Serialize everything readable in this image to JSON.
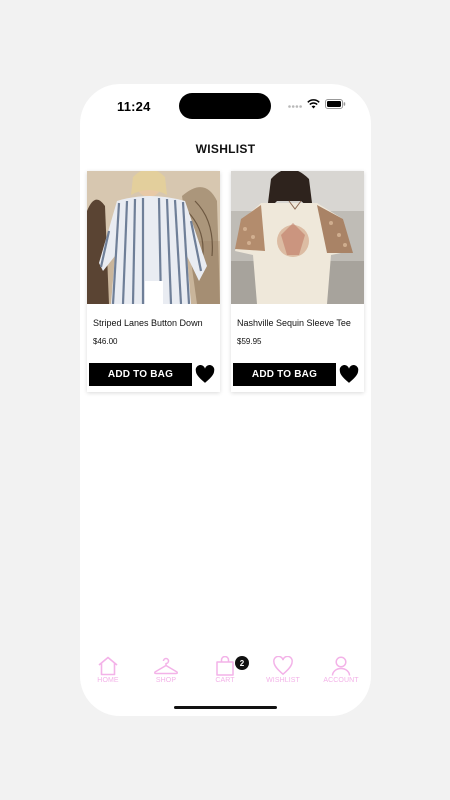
{
  "status_bar": {
    "time": "11:24"
  },
  "page": {
    "title": "WISHLIST"
  },
  "wishlist": {
    "items": [
      {
        "name": "Striped Lanes Button Down",
        "price": "$46.00",
        "button_label": "ADD TO BAG",
        "favorited": true
      },
      {
        "name": "Nashville Sequin Sleeve Tee",
        "price": "$59.95",
        "button_label": "ADD TO BAG",
        "favorited": true
      }
    ]
  },
  "tab_bar": {
    "accent_color": "#f3b2e8",
    "cart_badge": "2",
    "tabs": [
      {
        "label": "HOME",
        "icon": "house-icon"
      },
      {
        "label": "SHOP",
        "icon": "hanger-icon"
      },
      {
        "label": "CART",
        "icon": "bag-icon"
      },
      {
        "label": "WISHLIST",
        "icon": "heart-icon"
      },
      {
        "label": "ACCOUNT",
        "icon": "person-icon"
      }
    ]
  }
}
